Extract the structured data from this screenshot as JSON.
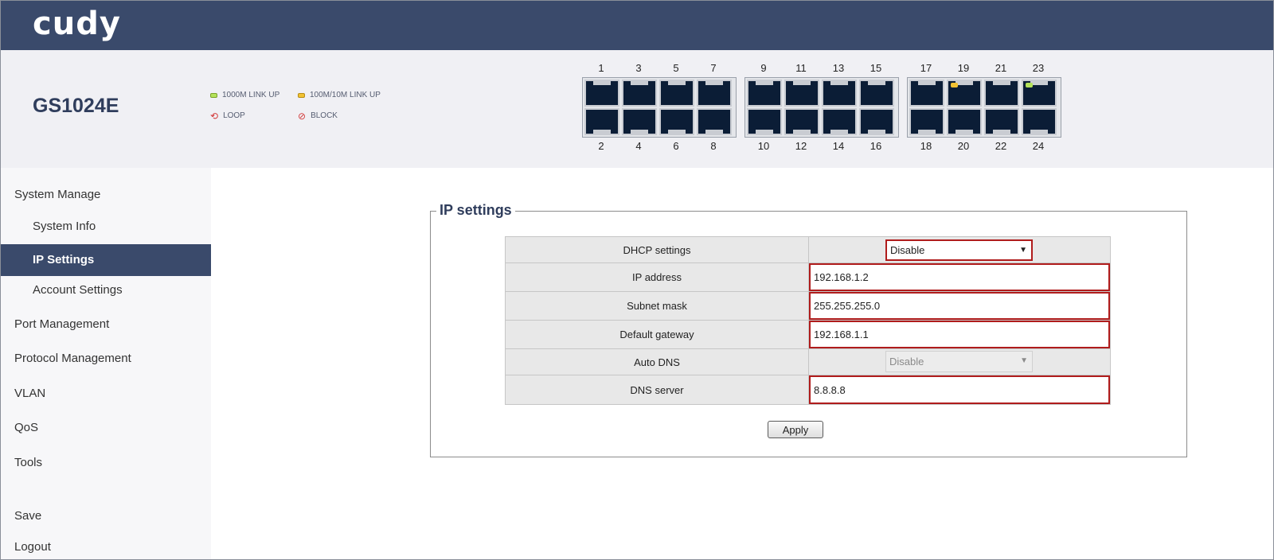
{
  "brand": {
    "logo": "cudy"
  },
  "device": {
    "model": "GS1024E"
  },
  "legend": {
    "gigabit": "1000M LINK UP",
    "fast": "100M/10M LINK UP",
    "loop": "LOOP",
    "block": "BLOCK"
  },
  "ports": {
    "group1": {
      "top": [
        "1",
        "3",
        "5",
        "7"
      ],
      "bottom": [
        "2",
        "4",
        "6",
        "8"
      ]
    },
    "group2": {
      "top": [
        "9",
        "11",
        "13",
        "15"
      ],
      "bottom": [
        "10",
        "12",
        "14",
        "16"
      ]
    },
    "group3": {
      "top": [
        "17",
        "19",
        "21",
        "23"
      ],
      "bottom": [
        "18",
        "20",
        "22",
        "24"
      ]
    },
    "status": {
      "19": "100M/10M",
      "23": "1000M"
    },
    "colors": {
      "link_1000m": "#b4e25a",
      "link_100m": "#f2c233"
    }
  },
  "sidebar": {
    "items": [
      {
        "label": "System Manage"
      },
      {
        "label": "System Info"
      },
      {
        "label": "IP Settings"
      },
      {
        "label": "Account Settings"
      },
      {
        "label": "Port Management"
      },
      {
        "label": "Protocol Management"
      },
      {
        "label": "VLAN"
      },
      {
        "label": "QoS"
      },
      {
        "label": "Tools"
      },
      {
        "label": "Save"
      },
      {
        "label": "Logout"
      }
    ]
  },
  "form": {
    "title": "IP settings",
    "dhcp_label": "DHCP settings",
    "dhcp_value": "Disable",
    "ip_label": "IP address",
    "ip_value": "192.168.1.2",
    "mask_label": "Subnet mask",
    "mask_value": "255.255.255.0",
    "gateway_label": "Default gateway",
    "gateway_value": "192.168.1.1",
    "autodns_label": "Auto DNS",
    "autodns_value": "Disable",
    "dns_label": "DNS server",
    "dns_value": "8.8.8.8",
    "apply_label": "Apply"
  },
  "theme": {
    "accent": "#3a4a6b",
    "error_border": "#b01c1c"
  }
}
